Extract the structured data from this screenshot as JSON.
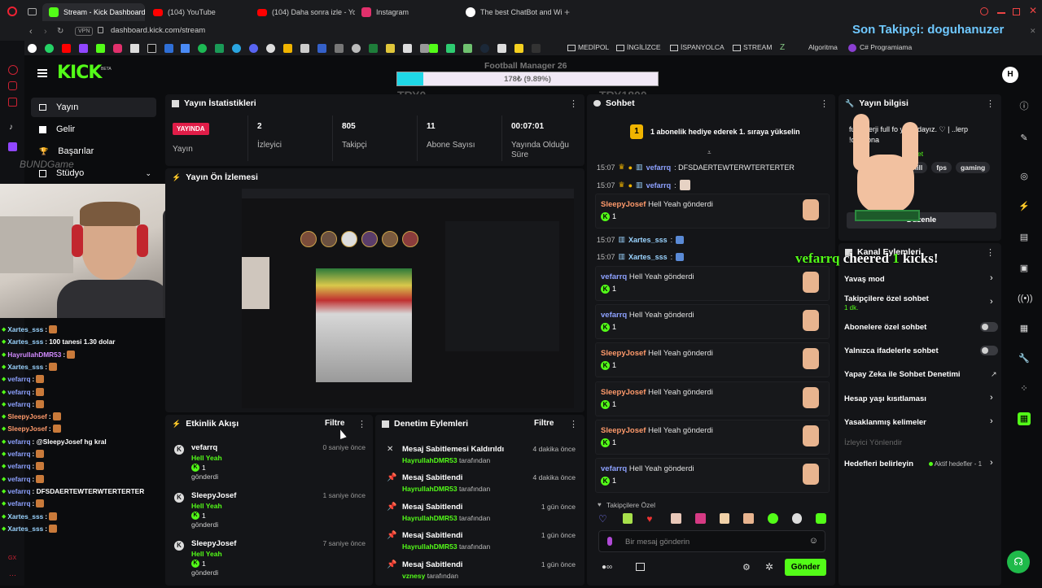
{
  "browser": {
    "tabs": [
      {
        "title": "Stream - Kick Dashboard",
        "color": "#53fc18"
      },
      {
        "title": "(104) YouTube",
        "color": "#ff0000"
      },
      {
        "title": "(104) Daha sonra izle - Yo",
        "color": "#ff0000"
      },
      {
        "title": "Instagram",
        "color": "#e1306c"
      },
      {
        "title": "The best ChatBot and Wi",
        "color": "#ffffff"
      }
    ],
    "vpn_label": "VPN",
    "url": "dashboard.kick.com/stream",
    "bookmarks": [
      "MEDİPOL",
      "İNGİLİZCE",
      "İSPANYOLCA",
      "STREAM",
      "Algoritma",
      "C# Programiama"
    ]
  },
  "overlay": {
    "follower_banner": "Son Takipçi: doguhanuzer",
    "goal_title": "Football Manager 26",
    "goal_progress_text": "178₺ (9.89%)",
    "goal_progress": 0.0989,
    "goal_left": "TRY0",
    "goal_right": "TRY1800",
    "cheer_user": "vefarrq",
    "cheer_text": "cheered",
    "cheer_amount": "1",
    "cheer_suffix": "kicks!",
    "watermark": "BUNDGame"
  },
  "kick": {
    "logo": "KICK",
    "logo_beta": "BETA",
    "avatar_letter": "H",
    "nav": [
      {
        "label": "Yayın",
        "active": true
      },
      {
        "label": "Gelir"
      },
      {
        "label": "Başarılar"
      },
      {
        "label": "Stüdyo"
      }
    ],
    "stats_panel": {
      "title": "Yayın İstatistikleri",
      "live_badge": "YAYINDA",
      "live_label": "Yayın",
      "items": [
        {
          "value": "2",
          "label": "İzleyici"
        },
        {
          "value": "805",
          "label": "Takipçi"
        },
        {
          "value": "11",
          "label": "Abone Sayısı"
        },
        {
          "value": "00:07:01",
          "label": "Yayında Olduğu Süre"
        }
      ]
    },
    "preview_panel": {
      "title": "Yayın Ön İzlemesi"
    },
    "activity_panel": {
      "title": "Etkinlik Akışı",
      "filter": "Filtre",
      "items": [
        {
          "user": "vefarrq",
          "sub": "Hell Yeah",
          "count": "1",
          "action": "gönderdi",
          "time": "0 saniye önce"
        },
        {
          "user": "SleepyJosef",
          "sub": "Hell Yeah",
          "count": "1",
          "action": "gönderdi",
          "time": "1 saniye önce"
        },
        {
          "user": "SleepyJosef",
          "sub": "Hell Yeah",
          "count": "1",
          "action": "gönderdi",
          "time": "7 saniye önce"
        }
      ]
    },
    "mod_panel": {
      "title": "Denetim Eylemleri",
      "filter": "Filtre",
      "items": [
        {
          "title": "Mesaj Sabitlemesi Kaldırıldı",
          "user": "HayrullahDMR53",
          "suffix": "tarafından",
          "time": "4 dakika önce"
        },
        {
          "title": "Mesaj Sabitlendi",
          "user": "HayrullahDMR53",
          "suffix": "tarafından",
          "time": "4 dakika önce"
        },
        {
          "title": "Mesaj Sabitlendi",
          "user": "HayrullahDMR53",
          "suffix": "tarafından",
          "time": "1 gün önce"
        },
        {
          "title": "Mesaj Sabitlendi",
          "user": "HayrullahDMR53",
          "suffix": "tarafından",
          "time": "1 gün önce"
        },
        {
          "title": "Mesaj Sabitlendi",
          "user": "vznesy",
          "suffix": "tarafından",
          "time": "1 gün önce"
        }
      ]
    },
    "chat_panel": {
      "title": "Sohbet",
      "gift_banner": "1 abonelik hediye ederek 1. sıraya yükselin",
      "gift_rank": "1",
      "messages": [
        {
          "time": "15:07",
          "user": "vefarrq",
          "text": ": DFSDAERTEWTERWTERTERTER"
        },
        {
          "time": "15:07",
          "user": "vefarrq",
          "text": ":"
        }
      ],
      "gifts": [
        {
          "user": "SleepyJosef",
          "text": "Hell Yeah gönderdi",
          "count": "1"
        },
        {
          "user": "vefarrq",
          "text": "Hell Yeah gönderdi",
          "count": "1"
        },
        {
          "user": "vefarrq",
          "text": "Hell Yeah gönderdi",
          "count": "1"
        },
        {
          "user": "SleepyJosef",
          "text": "Hell Yeah gönderdi",
          "count": "1"
        },
        {
          "user": "SleepyJosef",
          "text": "Hell Yeah gönderdi",
          "count": "1"
        },
        {
          "user": "SleepyJosef",
          "text": "Hell Yeah gönderdi",
          "count": "1"
        },
        {
          "user": "vefarrq",
          "text": "Hell Yeah gönderdi",
          "count": "1"
        }
      ],
      "xartes_lines": [
        {
          "time": "15:07",
          "user": "Xartes_sss",
          "text": ":"
        },
        {
          "time": "15:07",
          "user": "Xartes_sss",
          "text": ":"
        }
      ],
      "emote_label": "Takipçilere Özel",
      "input_placeholder": "Bir mesaj gönderin",
      "send": "Gönder"
    },
    "info_panel": {
      "title": "Yayın bilgisi",
      "title_text": "full enerji full fo yayındayız. ♡ | ..lerp !dc !dona",
      "category": "et",
      "tags": [
        "hill",
        "fps",
        "gaming"
      ],
      "edit": "Düzenle"
    },
    "channel_actions": {
      "title": "Kanal Eylemleri",
      "items": [
        {
          "label": "Yavaş mod"
        },
        {
          "label": "Takipçilere özel sohbet",
          "sub": "1 dk."
        },
        {
          "label": "Abonelere özel sohbet"
        },
        {
          "label": "Yalnızca ifadelerle sohbet"
        },
        {
          "label": "Yapay Zeka ile Sohbet Denetimi"
        },
        {
          "label": "Hesap yaşı kısıtlaması"
        },
        {
          "label": "Yasaklanmış kelimeler"
        },
        {
          "label": "İzleyici Yönlendir"
        },
        {
          "label": "Hedefleri belirleyin",
          "sub": "Aktif hedefler - 1"
        }
      ]
    }
  },
  "overlay_chat": [
    {
      "user": "Xartes_sss",
      "text": ":"
    },
    {
      "user": "Xartes_sss",
      "text": ": 100 tanesi 1.30 dolar"
    },
    {
      "user": "HayrullahDMR53",
      "text": ":"
    },
    {
      "user": "Xartes_sss",
      "text": ":"
    },
    {
      "user": "vefarrq",
      "text": ":"
    },
    {
      "user": "vefarrq",
      "text": ":"
    },
    {
      "user": "vefarrq",
      "text": ":"
    },
    {
      "user": "SleepyJosef",
      "text": ":"
    },
    {
      "user": "SleepyJosef",
      "text": ":"
    },
    {
      "user": "vefarrq",
      "text": ": @SleepyJosef hg kral"
    },
    {
      "user": "vefarrq",
      "text": ":"
    },
    {
      "user": "vefarrq",
      "text": ":"
    },
    {
      "user": "vefarrq",
      "text": ":"
    },
    {
      "user": "vefarrq",
      "text": ": DFSDAERTEWTERWTERTERTER"
    },
    {
      "user": "vefarrq",
      "text": ":"
    },
    {
      "user": "Xartes_sss",
      "text": ":"
    },
    {
      "user": "Xartes_sss",
      "text": ":"
    }
  ],
  "opera_label": "GX"
}
